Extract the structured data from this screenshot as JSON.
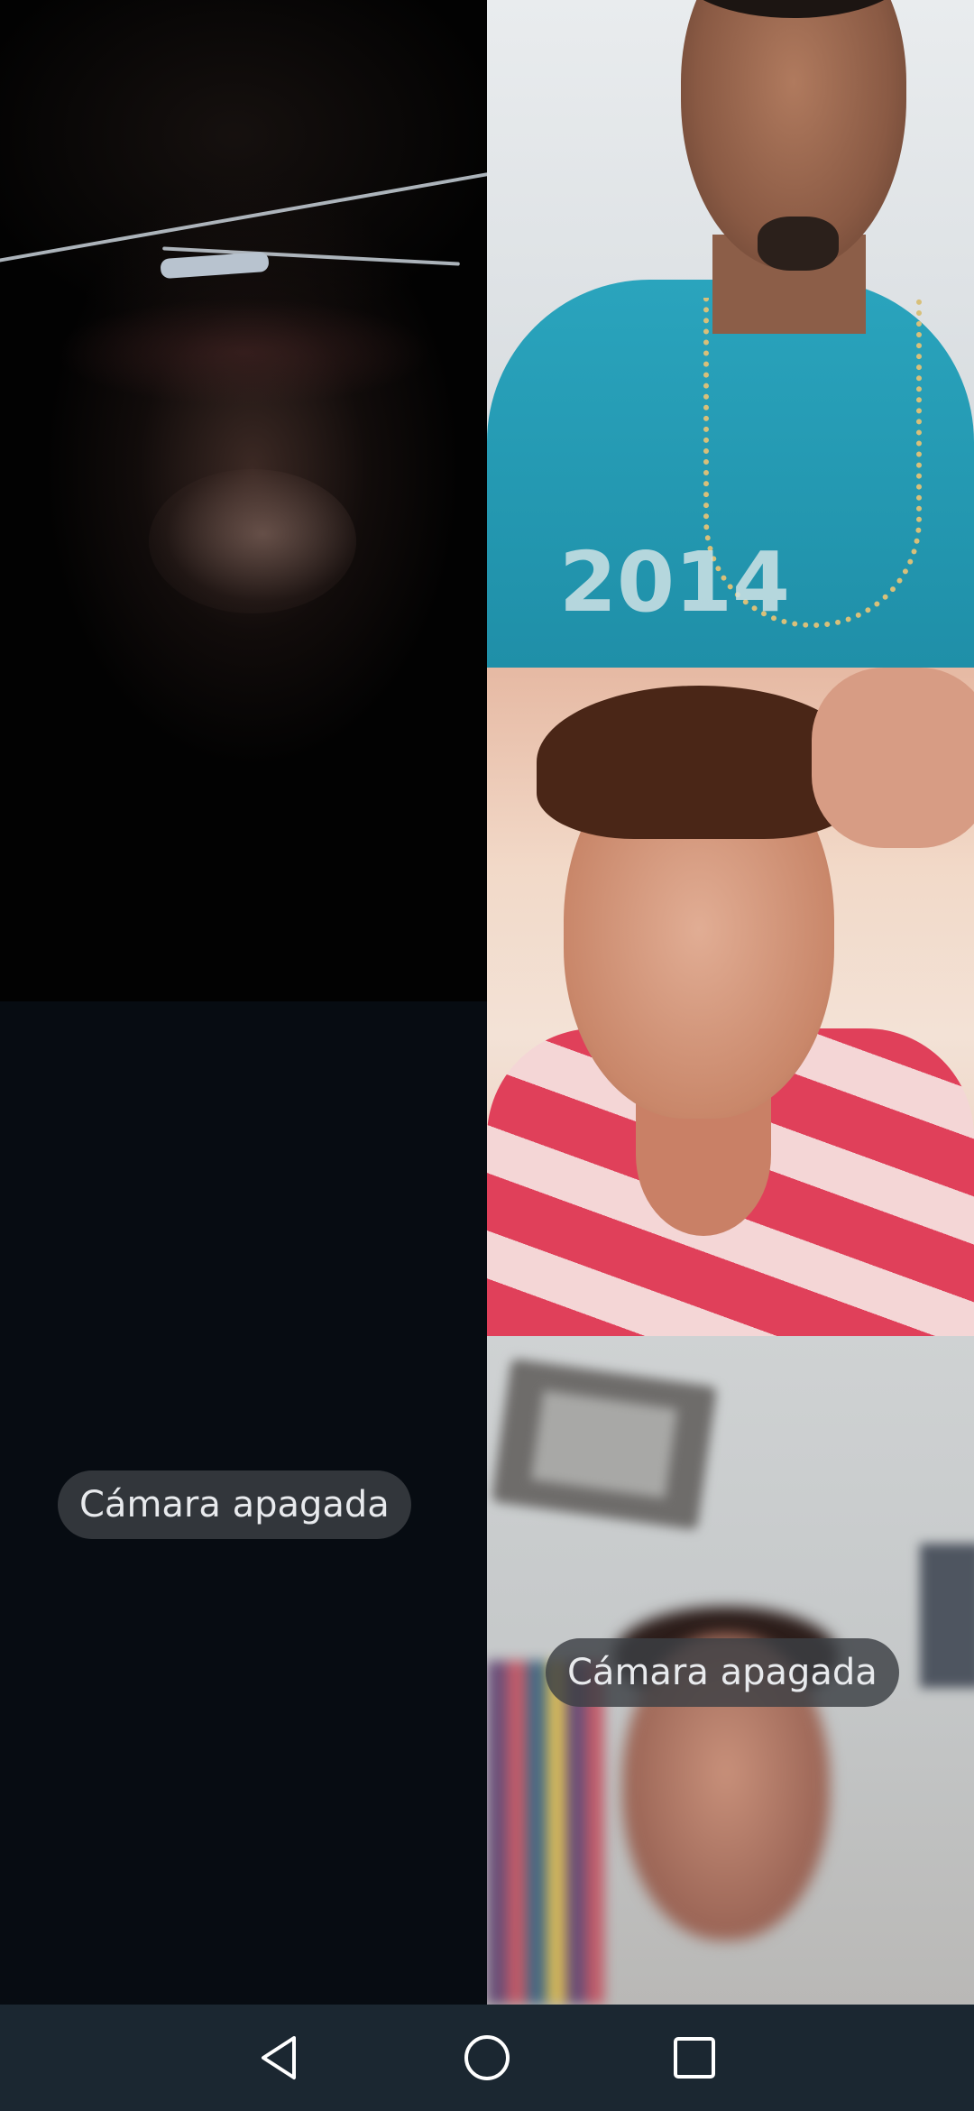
{
  "participants": [
    {
      "id": "participant-1",
      "camera_on": true
    },
    {
      "id": "participant-2",
      "camera_on": true
    },
    {
      "id": "participant-3",
      "camera_on": true
    },
    {
      "id": "participant-4",
      "camera_on": false,
      "status_text": "Cámara apagada"
    },
    {
      "id": "participant-5",
      "camera_on": false,
      "status_text": "Cámara apagada"
    }
  ],
  "shirt_print_text": "2014",
  "navigation_bar": {
    "buttons": [
      {
        "icon": "back-triangle-icon"
      },
      {
        "icon": "home-circle-icon"
      },
      {
        "icon": "recents-square-icon"
      }
    ],
    "background_color": "#1b2731",
    "icon_color": "#ffffff"
  },
  "colors": {
    "pill_background": "#3c4044",
    "pill_text": "#e8eaed",
    "empty_tile_background": "#070c12"
  }
}
